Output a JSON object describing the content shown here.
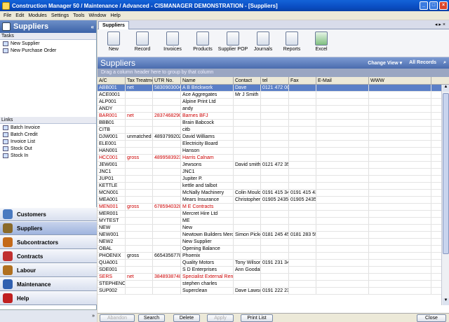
{
  "window": {
    "title": "Construction Manager 50 / Maintenance / Advanced  - CISMANAGER  DEMONSTRATION - [Suppliers]"
  },
  "menu": [
    "File",
    "Edit",
    "Modules",
    "Settings",
    "Tools",
    "Window",
    "Help"
  ],
  "left": {
    "header": "Suppliers",
    "tasks_title": "Tasks",
    "tasks": [
      "New Supplier",
      "New Purchase Order"
    ],
    "links_title": "Links",
    "links": [
      "Batch Invoice",
      "Batch Credit",
      "Invoice List",
      "Stock Out",
      "Stock In"
    ],
    "nav": [
      "Customers",
      "Suppliers",
      "Subcontractors",
      "Contracts",
      "Labour",
      "Maintenance",
      "Help"
    ],
    "nav_colors": [
      "#4a7ac0",
      "#8a6a2a",
      "#c46a1a",
      "#c03030",
      "#b07020",
      "#3060b0",
      "#c02020"
    ]
  },
  "tab": "Suppliers",
  "toolbar": [
    "New",
    "Record",
    "Invoices",
    "Products",
    "Supplier POP",
    "Journals",
    "Reports",
    "Excel"
  ],
  "grid": {
    "title": "Suppliers",
    "change_view": "Change View ▾",
    "all_records": "All Records",
    "groupby": "Drag a column header here to group by that column",
    "columns": [
      "A/C",
      "Tax Treatme",
      "UTR No.",
      "Name",
      "Contact",
      "tel",
      "Fax",
      "E-Mail",
      "WWW"
    ],
    "rows": [
      {
        "c": [
          "ABB001",
          "net",
          "5830903004",
          "A B Brickwork",
          "Dave",
          "0121 472 00",
          "",
          "",
          ""
        ],
        "style": "sel"
      },
      {
        "c": [
          "ACE0001",
          "",
          "",
          "Ace Aggregates",
          "Mr J Smith",
          "",
          "",
          "",
          ""
        ]
      },
      {
        "c": [
          "ALP001",
          "",
          "",
          "Alpine Print Ltd",
          "",
          "",
          "",
          "",
          ""
        ]
      },
      {
        "c": [
          "ANDY",
          "",
          "",
          "andy",
          "",
          "",
          "",
          "",
          ""
        ]
      },
      {
        "c": [
          "BAR001",
          "net",
          "2837468290",
          "Barnes BFJ",
          "",
          "",
          "",
          "",
          ""
        ],
        "style": "red"
      },
      {
        "c": [
          "BBB01",
          "",
          "",
          "Brain Babcock",
          "",
          "",
          "",
          "",
          ""
        ]
      },
      {
        "c": [
          "CITB",
          "",
          "",
          "citb",
          "",
          "",
          "",
          "",
          ""
        ]
      },
      {
        "c": [
          "DJW001",
          "unmatched",
          "4893799202",
          "David Williams",
          "",
          "",
          "",
          "",
          ""
        ]
      },
      {
        "c": [
          "ELE001",
          "",
          "",
          "Electricity Board",
          "",
          "",
          "",
          "",
          ""
        ]
      },
      {
        "c": [
          "HAN001",
          "",
          "",
          "Hanson",
          "",
          "",
          "",
          "",
          ""
        ]
      },
      {
        "c": [
          "HCC001",
          "gross",
          "4899583923",
          "Harris Calnam",
          "",
          "",
          "",
          "",
          ""
        ],
        "style": "red"
      },
      {
        "c": [
          "JEW001",
          "",
          "",
          "Jewsons",
          "David smith",
          "0121 472 35",
          "",
          "",
          ""
        ]
      },
      {
        "c": [
          "JNC1",
          "",
          "",
          "JNC1",
          "",
          "",
          "",
          "",
          ""
        ]
      },
      {
        "c": [
          "JUP01",
          "",
          "",
          "Jupiter P.",
          "",
          "",
          "",
          "",
          ""
        ]
      },
      {
        "c": [
          "KETTLE",
          "",
          "",
          "kettle and talbot",
          "",
          "",
          "",
          "",
          ""
        ]
      },
      {
        "c": [
          "MCN001",
          "",
          "",
          "McNally Machinery",
          "Colin Mould",
          "0191 415 34",
          "0191 415 43",
          "",
          ""
        ]
      },
      {
        "c": [
          "MEA001",
          "",
          "",
          "Mears Insurance",
          "Christopher M",
          "01905 2435",
          "01905 2435",
          "",
          ""
        ]
      },
      {
        "c": [
          "MEN001",
          "gross",
          "6785940328",
          "M E Contracts",
          "",
          "",
          "",
          "",
          ""
        ],
        "style": "red"
      },
      {
        "c": [
          "MER001",
          "",
          "",
          "Mercret Hire Ltd",
          "",
          "",
          "",
          "",
          ""
        ]
      },
      {
        "c": [
          "MYTEST",
          "",
          "",
          "ME",
          "",
          "",
          "",
          "",
          ""
        ]
      },
      {
        "c": [
          "NEW",
          "",
          "",
          "New",
          "",
          "",
          "",
          "",
          ""
        ]
      },
      {
        "c": [
          "NEW001",
          "",
          "",
          "Newtown Builders Merch",
          "Simon Picke",
          "0181 245 45",
          "0181 283 55",
          "",
          ""
        ]
      },
      {
        "c": [
          "NEW2",
          "",
          "",
          "New Supplier",
          "",
          "",
          "",
          "",
          ""
        ]
      },
      {
        "c": [
          "OBAL",
          "",
          "",
          "Opening Balance",
          "",
          "",
          "",
          "",
          ""
        ]
      },
      {
        "c": [
          "PHOENIX",
          "gross",
          "6654356778",
          "Phoenix",
          "",
          "",
          "",
          "",
          ""
        ]
      },
      {
        "c": [
          "QUA001",
          "",
          "",
          "Quality Motors",
          "Tony Wilson",
          "0191 231 34",
          "",
          "",
          ""
        ]
      },
      {
        "c": [
          "SDE001",
          "",
          "",
          "S D Enterprises",
          "Ann Goodall",
          "",
          "",
          "",
          ""
        ]
      },
      {
        "c": [
          "SERS",
          "net",
          "3848938748",
          "Specialist External Rend",
          "",
          "",
          "",
          "",
          ""
        ],
        "style": "red"
      },
      {
        "c": [
          "STEPHENC",
          "",
          "",
          "stephen charles",
          "",
          "",
          "",
          "",
          ""
        ]
      },
      {
        "c": [
          "SUP002",
          "",
          "",
          "Superclean",
          "Dave Lawsc",
          "0191 222 23",
          "",
          "",
          ""
        ]
      }
    ]
  },
  "bottom": {
    "abandon": "Abandon",
    "search": "Search",
    "delete": "Delete",
    "apply": "Apply",
    "print": "Print List",
    "close": "Close"
  }
}
